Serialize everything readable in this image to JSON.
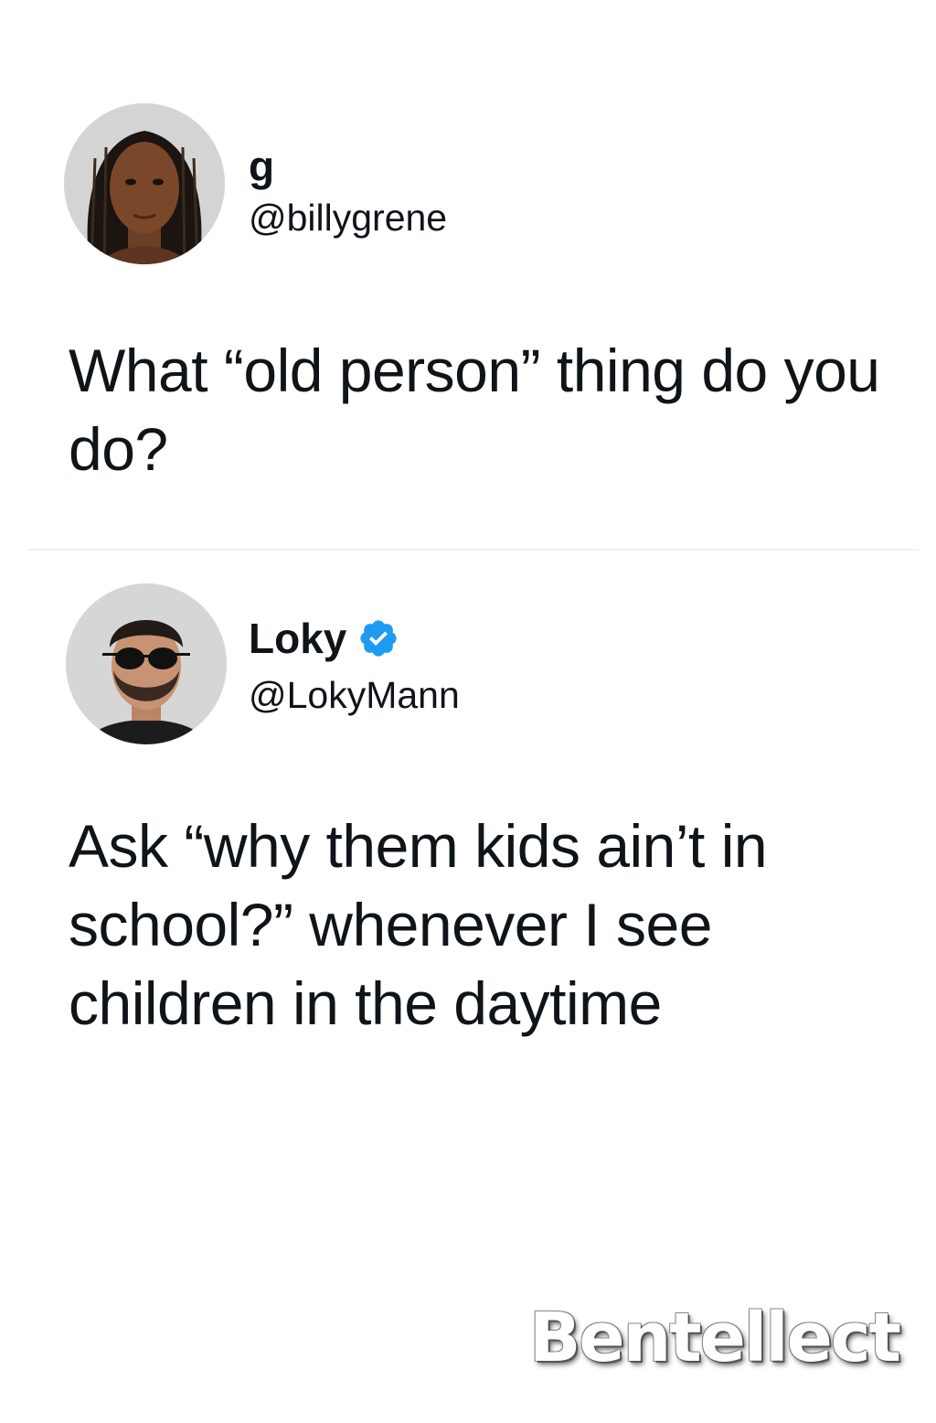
{
  "posts": [
    {
      "display_name": "g",
      "handle": "@billygrene",
      "verified": false,
      "text": "What “old person” thing do you do?",
      "avatar_icon": "woman-portrait-avatar"
    },
    {
      "display_name": "Loky",
      "handle": "@LokyMann",
      "verified": true,
      "text": "Ask “why them kids ain’t in school?” whenever I see children in the daytime",
      "avatar_icon": "man-sunglasses-avatar"
    }
  ],
  "watermark": "Bentellect",
  "colors": {
    "text": "#0f1419",
    "verified_badge": "#1d9bf0",
    "background": "#ffffff"
  }
}
